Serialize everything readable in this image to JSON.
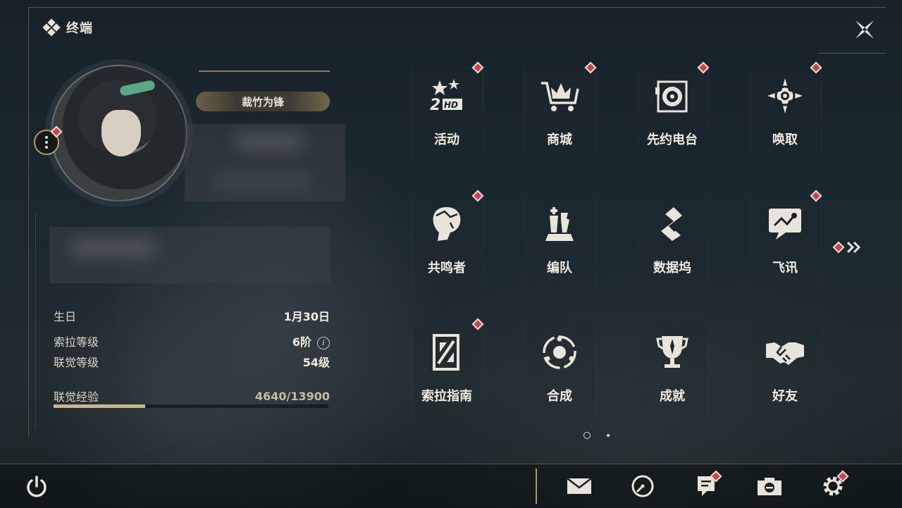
{
  "window": {
    "title": "终端"
  },
  "profile": {
    "title_badge": "裁竹为锋",
    "birthday_label": "生日",
    "birthday_value": "1月30日",
    "sola_level_label": "索拉等级",
    "sola_level_value": "6阶",
    "info_symbol": "i",
    "union_level_label": "联觉等级",
    "union_level_value": "54级",
    "union_exp_label": "联觉经验",
    "union_exp_value": "4640/13900",
    "union_exp_progress": 0.334
  },
  "menu": {
    "tiles": [
      {
        "label": "活动",
        "icon": "event-2hd-icon",
        "badge": true
      },
      {
        "label": "商城",
        "icon": "crown-cart-icon",
        "badge": true
      },
      {
        "label": "先约电台",
        "icon": "radio-disc-icon",
        "badge": true
      },
      {
        "label": "唤取",
        "icon": "compass-star-icon",
        "badge": true
      },
      {
        "label": "共鸣者",
        "icon": "resonator-head-icon",
        "badge": true
      },
      {
        "label": "编队",
        "icon": "chess-team-icon",
        "badge": false
      },
      {
        "label": "数据坞",
        "icon": "data-dock-icon",
        "badge": false
      },
      {
        "label": "飞讯",
        "icon": "chat-bubble-icon",
        "badge": true
      },
      {
        "label": "索拉指南",
        "icon": "guide-book-icon",
        "badge": true
      },
      {
        "label": "合成",
        "icon": "synthesis-orb-icon",
        "badge": false
      },
      {
        "label": "成就",
        "icon": "trophy-icon",
        "badge": false
      },
      {
        "label": "好友",
        "icon": "handshake-icon",
        "badge": false
      }
    ],
    "next_page_icon": "double-chevron-right-icon",
    "page_count": 2,
    "current_page": 1
  },
  "bottom_bar": {
    "buttons": [
      {
        "icon": "mail-icon",
        "badge": false
      },
      {
        "icon": "clock-icon",
        "badge": false
      },
      {
        "icon": "notice-icon",
        "badge": true
      },
      {
        "icon": "camera-icon",
        "badge": false
      },
      {
        "icon": "settings-gear-icon",
        "badge": true
      }
    ],
    "power_icon": "power-icon"
  },
  "colors": {
    "accent_gold": "#cdb58a",
    "badge_red": "#d0404a",
    "text": "#f0ece2"
  }
}
